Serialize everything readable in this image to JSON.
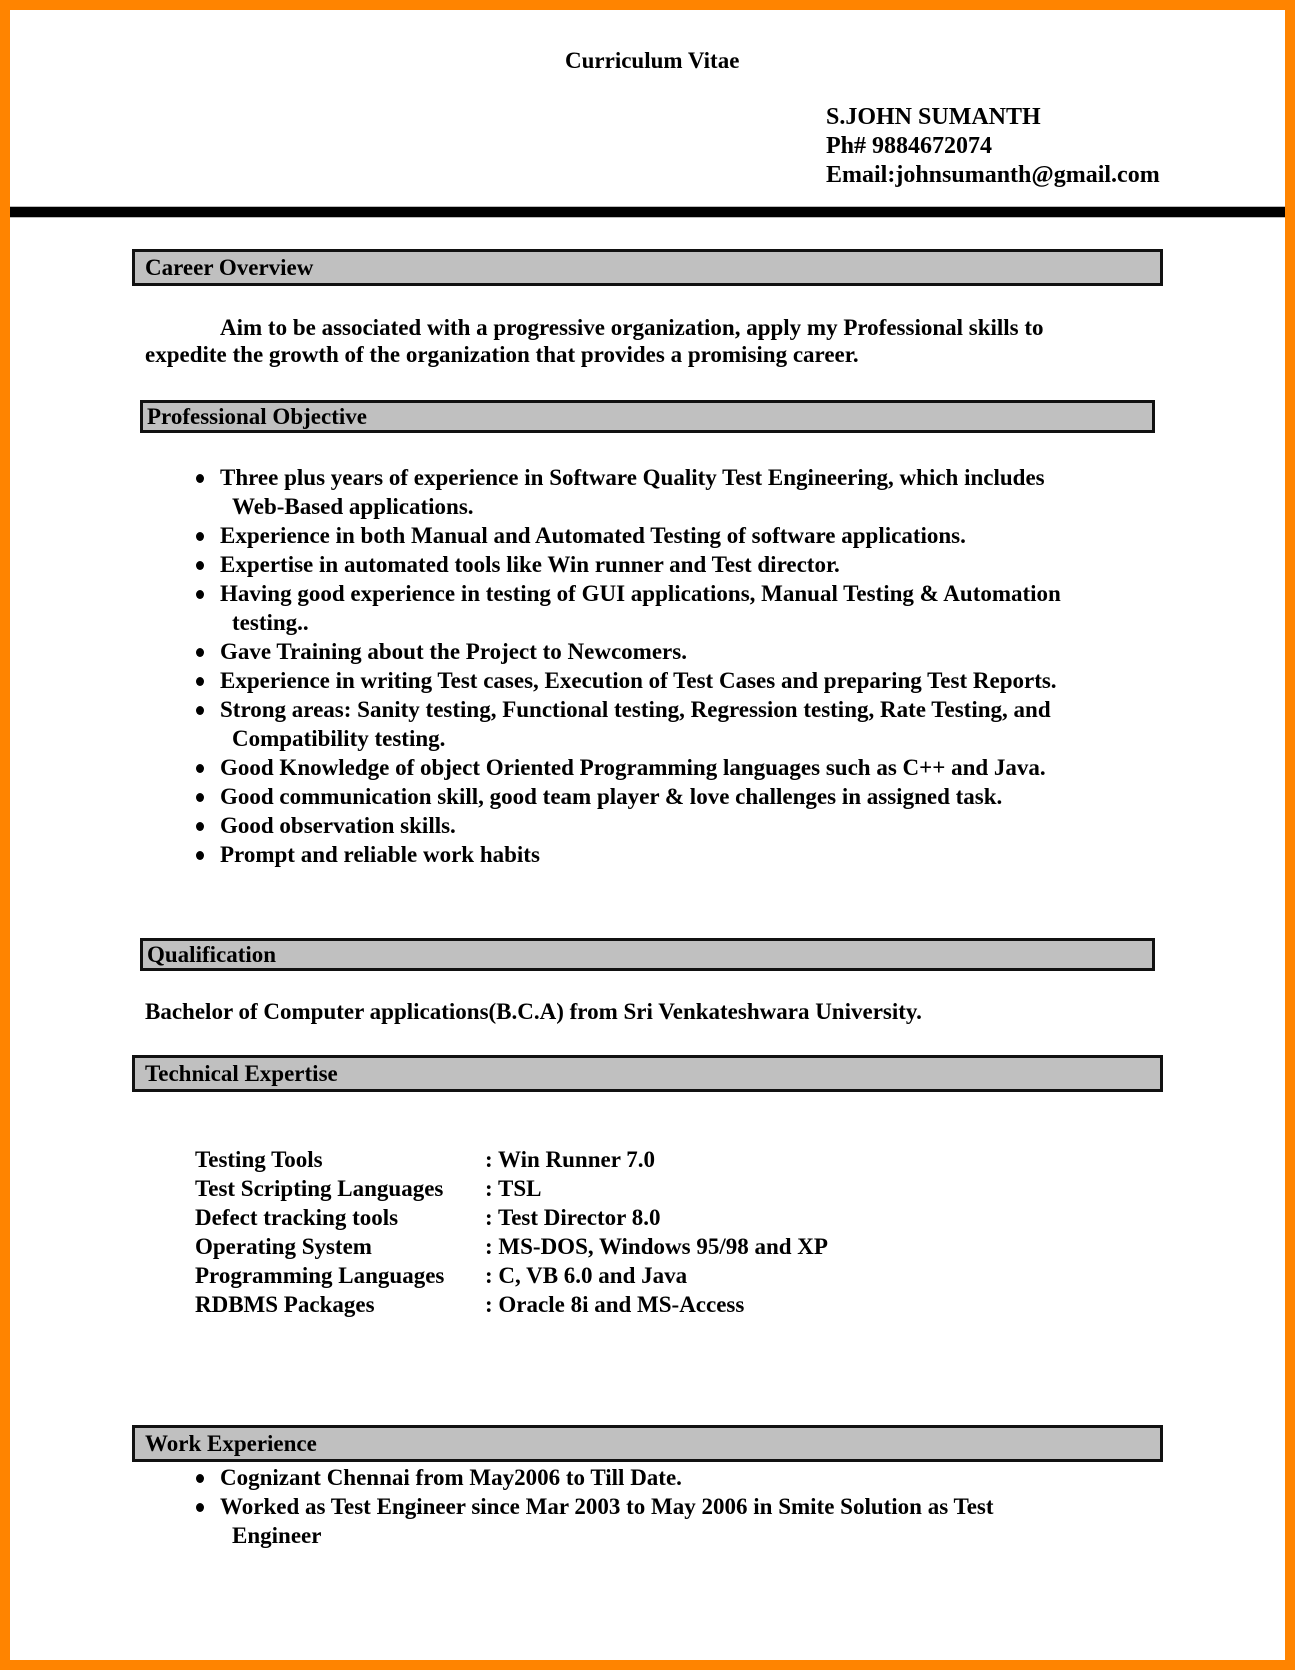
{
  "document": {
    "title": "Curriculum Vitae",
    "contact": {
      "name": "S.JOHN SUMANTH",
      "phone": "Ph# 9884672074",
      "email": "Email:johnsumanth@gmail.com"
    },
    "colors": {
      "frame": "#ff8400",
      "section_fill": "#c0c0c0",
      "rule": "#000000"
    }
  },
  "sections": {
    "career_overview": {
      "heading": "Career Overview",
      "line1": "Aim to be associated with a progressive organization, apply my Professional skills to",
      "line2": "expedite the growth of the organization that provides a promising career."
    },
    "professional_objective": {
      "heading": "Professional Objective",
      "items": [
        {
          "line1": "Three plus years of experience in Software Quality Test Engineering, which includes",
          "line2": "Web-Based applications."
        },
        {
          "line1": "Experience in both Manual and Automated Testing of software applications."
        },
        {
          "line1": "Expertise in automated tools like Win runner and Test director."
        },
        {
          "line1": "Having good experience in testing of GUI applications, Manual Testing & Automation",
          "line2": "testing.."
        },
        {
          "line1": "Gave Training about the Project to Newcomers."
        },
        {
          "line1": "Experience in writing Test cases, Execution of Test Cases and preparing Test Reports."
        },
        {
          "line1": "Strong areas: Sanity testing, Functional testing, Regression testing, Rate Testing, and",
          "line2": "Compatibility testing."
        },
        {
          "line1": "Good Knowledge of object Oriented Programming languages such as C++ and Java."
        },
        {
          "line1": "Good communication skill, good team player & love challenges in assigned task."
        },
        {
          "line1": "Good observation skills."
        },
        {
          "line1": "Prompt and reliable work habits"
        }
      ]
    },
    "qualification": {
      "heading": "Qualification",
      "text": "Bachelor of Computer applications(B.C.A)  from Sri Venkateshwara University."
    },
    "technical_expertise": {
      "heading": "Technical Expertise",
      "rows": [
        {
          "label": "Testing Tools",
          "value": ":  Win Runner 7.0"
        },
        {
          "label": "Test Scripting Languages",
          "value": ":  TSL"
        },
        {
          "label": "Defect tracking tools",
          "value": ":  Test Director 8.0"
        },
        {
          "label": "Operating System",
          "value": ": MS-DOS, Windows 95/98 and XP"
        },
        {
          "label": "Programming Languages",
          "value": ":  C, VB 6.0 and Java"
        },
        {
          "label": "RDBMS Packages",
          "value": ":  Oracle 8i and MS-Access"
        }
      ]
    },
    "work_experience": {
      "heading": "Work Experience",
      "items": [
        {
          "line1": "Cognizant Chennai from May2006 to Till Date."
        },
        {
          "line1": "Worked as Test Engineer since Mar 2003 to May 2006 in Smite Solution as Test",
          "line2": "Engineer"
        }
      ]
    }
  }
}
